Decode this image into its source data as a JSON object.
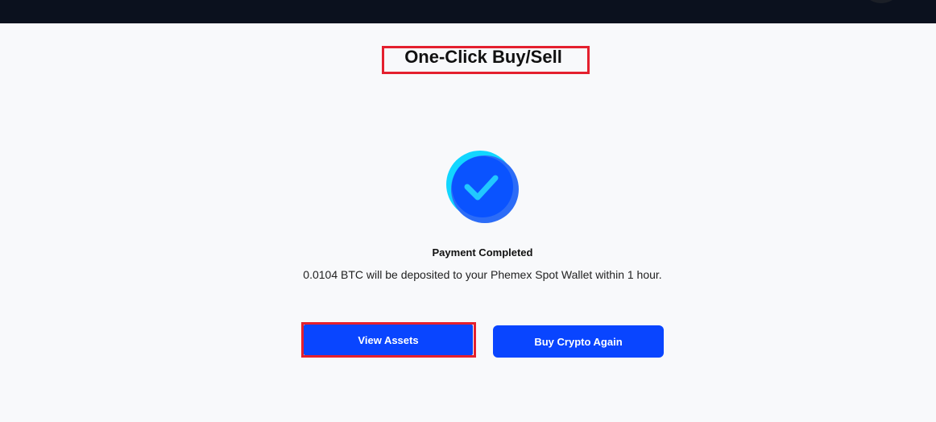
{
  "header": {
    "title": "One-Click Buy/Sell"
  },
  "status": {
    "icon": "check-circle-icon",
    "title": "Payment Completed",
    "message": "0.0104 BTC will be deposited to your Phemex Spot Wallet within 1 hour."
  },
  "actions": {
    "view_assets": "View Assets",
    "buy_again": "Buy Crypto Again"
  },
  "colors": {
    "primary": "#0945ff",
    "check_inner": "#1f6bff",
    "check_outer": "#12d6ff",
    "highlight": "#e4202e",
    "topbar": "#0b111e"
  }
}
